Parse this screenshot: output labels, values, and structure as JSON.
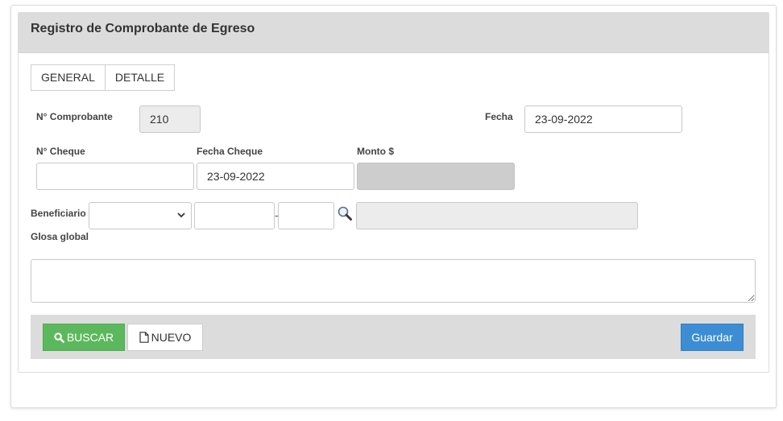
{
  "panel": {
    "title": "Registro de Comprobante de Egreso"
  },
  "tabs": [
    {
      "label": "GENERAL"
    },
    {
      "label": "DETALLE"
    }
  ],
  "form": {
    "comprobante_label": "N° Comprobante",
    "comprobante_value": "210",
    "fecha_label": "Fecha",
    "fecha_value": "23-09-2022",
    "cheque_label": "N° Cheque",
    "cheque_value": "",
    "fecha_cheque_label": "Fecha Cheque",
    "fecha_cheque_value": "23-09-2022",
    "monto_label": "Monto $",
    "monto_value": "",
    "beneficiario_label": "Beneficiario",
    "beneficiario_select_value": "",
    "rut_value": "",
    "dv_value": "",
    "rut_separator": "-",
    "beneficiario_name_value": "",
    "glosa_label": "Glosa global",
    "glosa_value": ""
  },
  "actions": {
    "buscar_label": "BUSCAR",
    "nuevo_label": "NUEVO",
    "guardar_label": "Guardar"
  },
  "icons": {
    "buscar": "search-icon",
    "nuevo": "file-icon",
    "lookup": "magnifier-icon",
    "select": "chevron-down-icon"
  },
  "colors": {
    "header_bg": "#dcdcdc",
    "buscar_bg": "#5cb85c",
    "guardar_bg": "#3c8dd4",
    "disabled_bg": "#cdcdcd"
  }
}
